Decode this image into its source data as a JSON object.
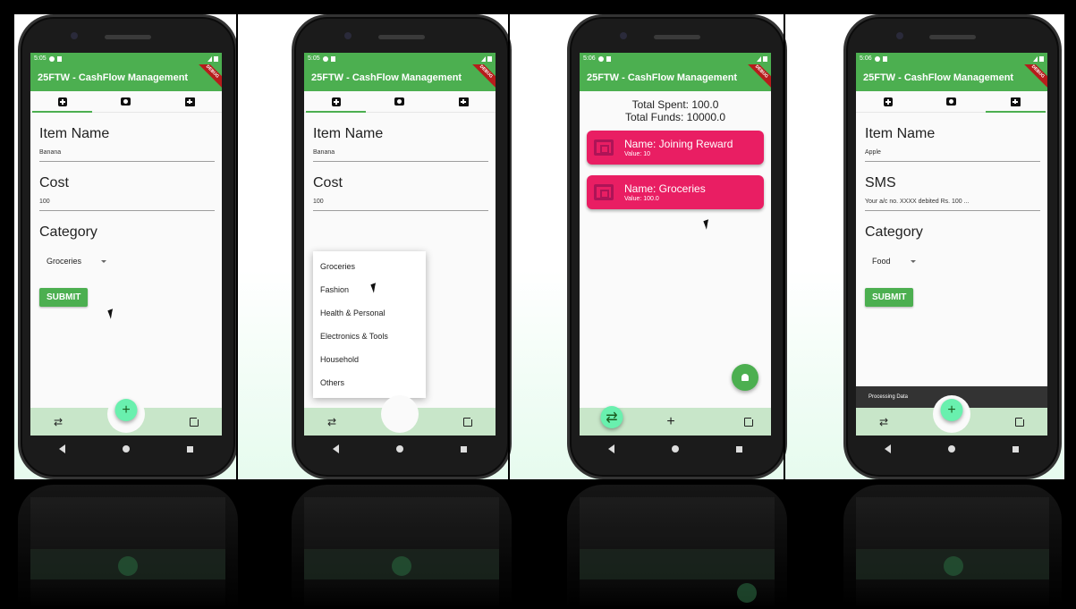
{
  "app": {
    "title": "25FTW - CashFlow Management",
    "debug_badge": "DEBUG",
    "colors": {
      "primary": "#4caf50",
      "card": "#e91e63",
      "nav": "#c8e6c9",
      "fab": "#69f0ae"
    }
  },
  "screens": [
    {
      "status_time": "5:05",
      "tabs": [
        "add-icon",
        "camera-icon",
        "message-add-icon"
      ],
      "active_tab": 0,
      "form": {
        "item_name_label": "Item Name",
        "item_name_value": "Banana",
        "cost_label": "Cost",
        "cost_value": "100",
        "category_label": "Category",
        "category_value": "Groceries",
        "submit_label": "SUBMIT"
      },
      "fab": "+"
    },
    {
      "status_time": "5:05",
      "active_tab": 0,
      "form": {
        "item_name_label": "Item Name",
        "item_name_value": "Banana",
        "cost_label": "Cost",
        "cost_value": "100"
      },
      "menu": [
        "Groceries",
        "Fashion",
        "Health & Personal",
        "Electronics & Tools",
        "Household",
        "Others"
      ]
    },
    {
      "status_time": "5:06",
      "total_spent": "Total Spent: 100.0",
      "total_funds": "Total Funds: 10000.0",
      "cards": [
        {
          "name": "Name: Joining Reward",
          "value": "Value: 10"
        },
        {
          "name": "Name: Groceries",
          "value": "Value: 100.0"
        }
      ],
      "fab": "+"
    },
    {
      "status_time": "5:06",
      "active_tab": 2,
      "form": {
        "item_name_label": "Item Name",
        "item_name_value": "Apple",
        "sms_label": "SMS",
        "sms_value": "Your a/c no. XXXX debited Rs. 100 ...",
        "category_label": "Category",
        "category_value": "Food",
        "submit_label": "SUBMIT"
      },
      "snackbar": "Processing Data",
      "fab": "+"
    }
  ]
}
